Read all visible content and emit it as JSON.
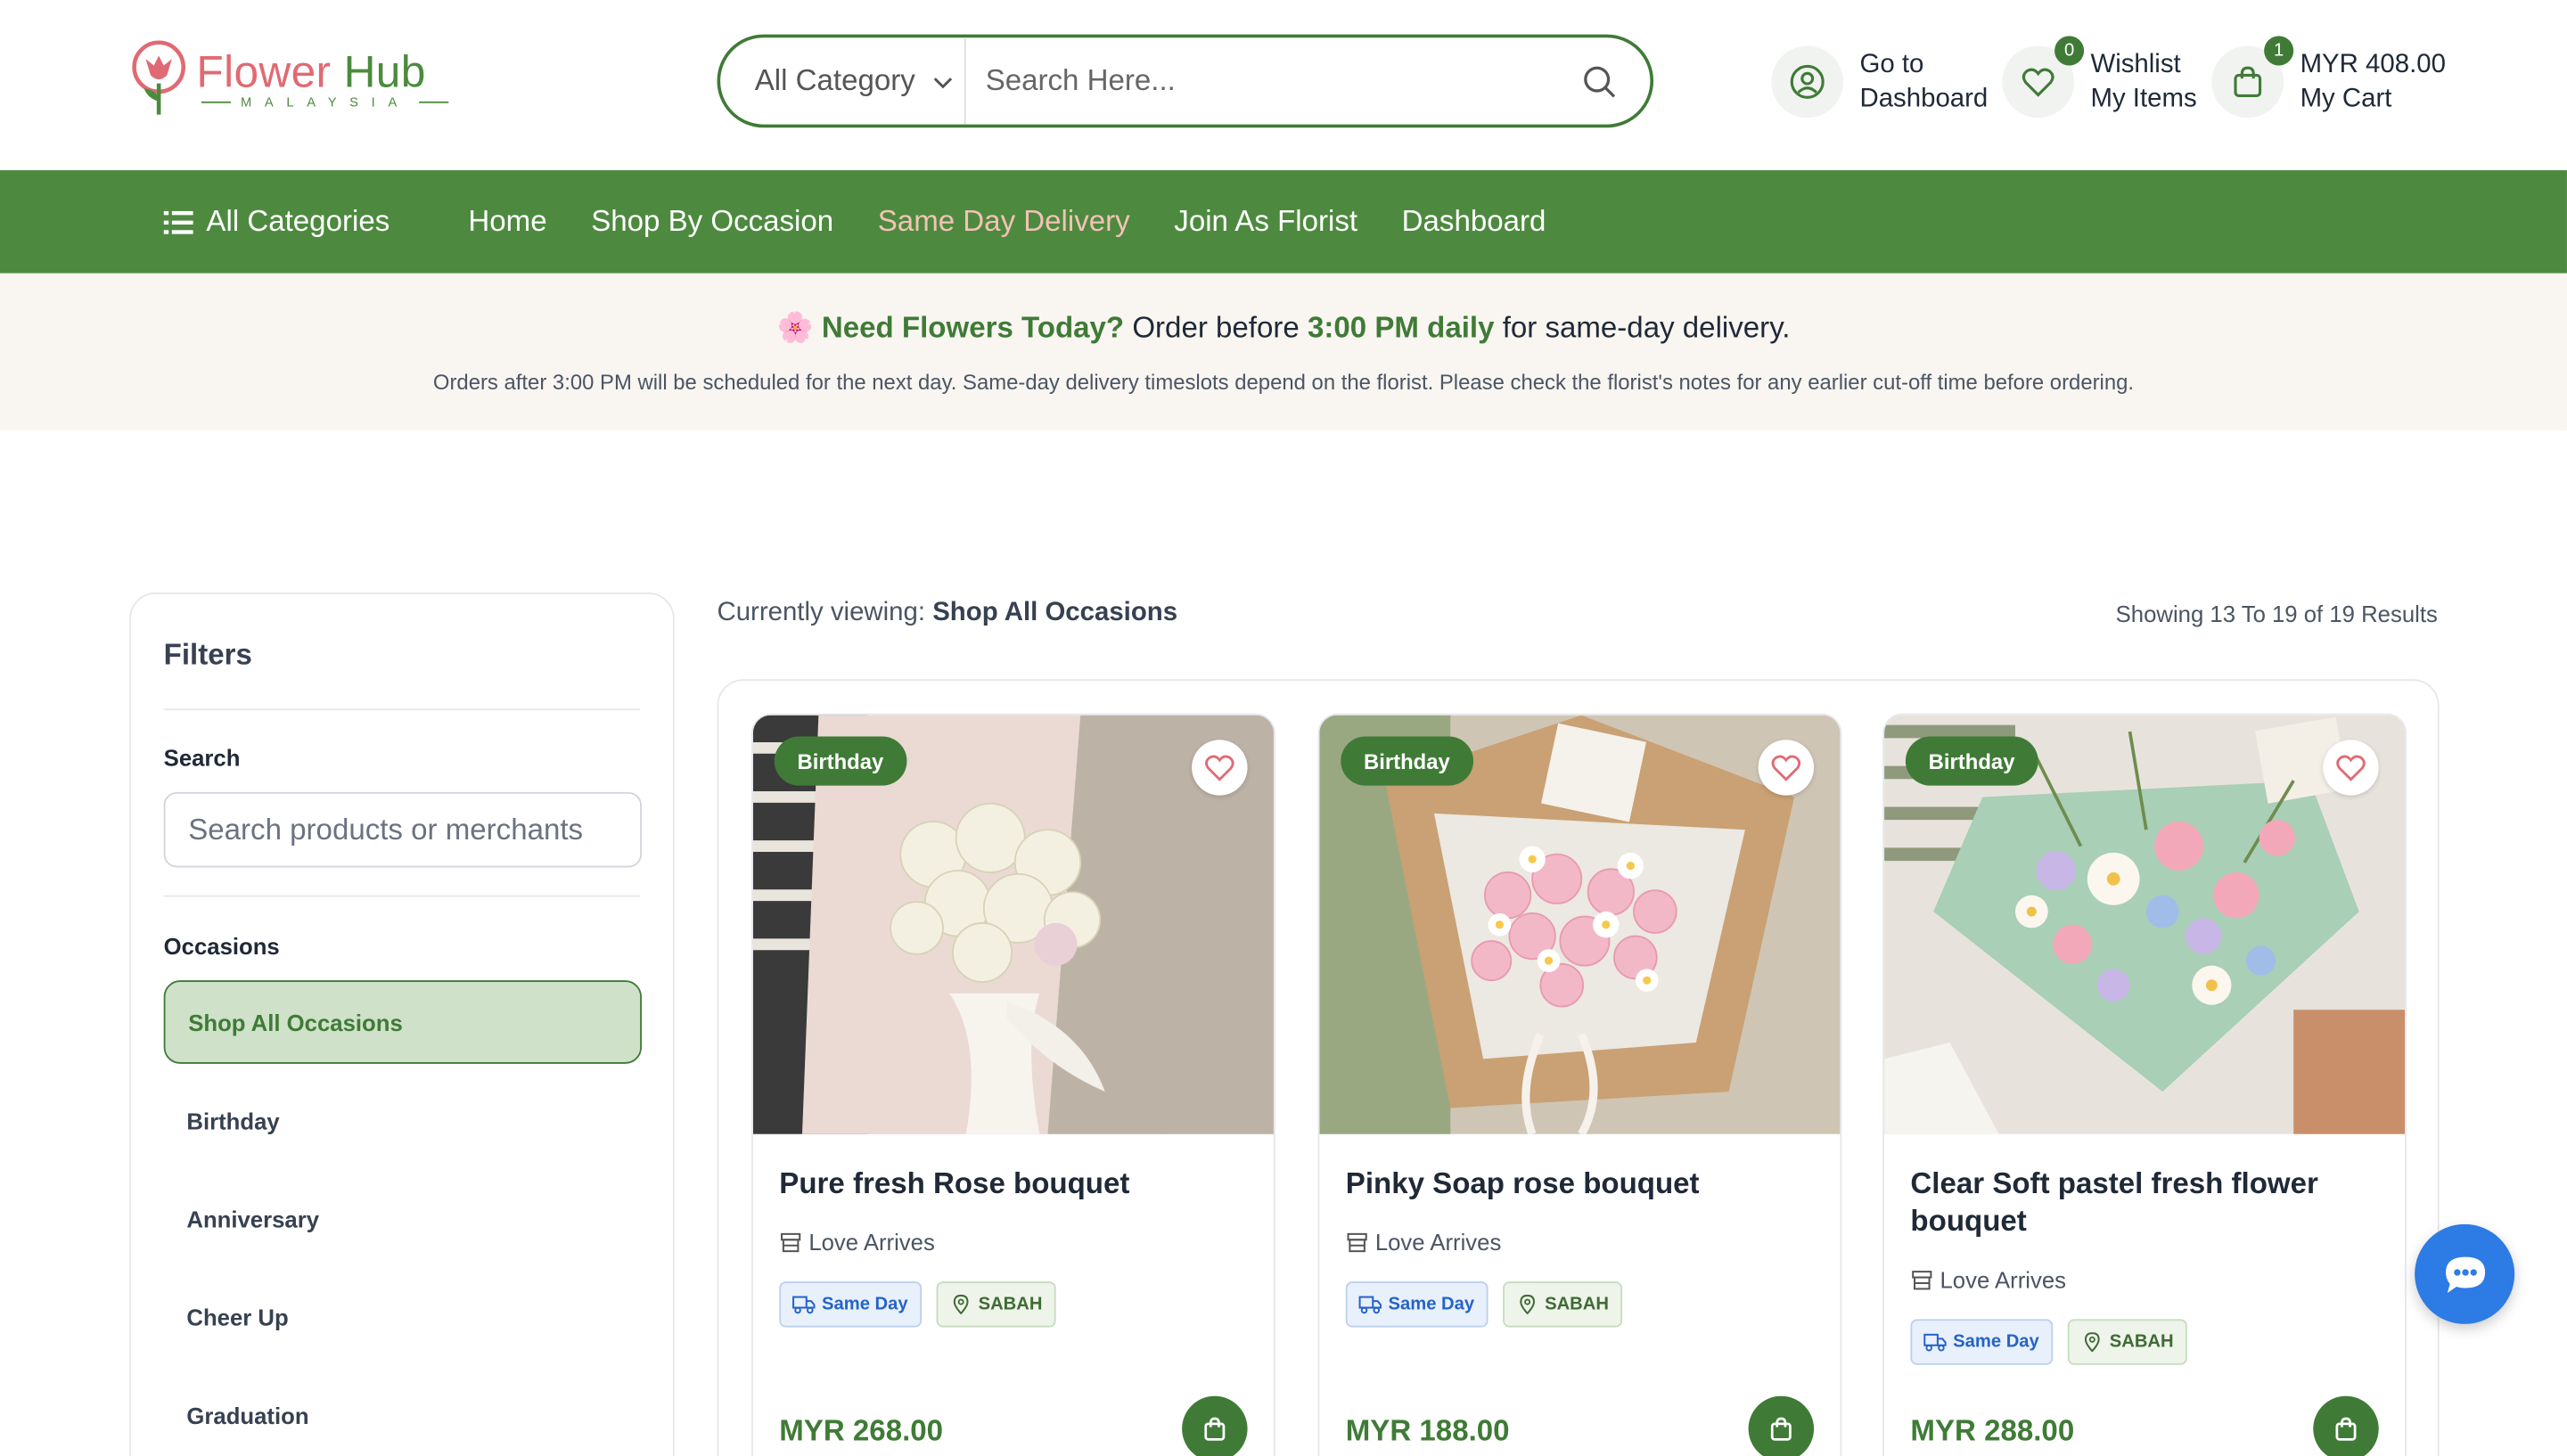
{
  "header": {
    "logo_name_a": "Flower",
    "logo_name_b": "Hub",
    "logo_sub": "MALAYSIA",
    "search_category": "All Category",
    "search_placeholder": "Search Here...",
    "dashboard_line1": "Go to",
    "dashboard_line2": "Dashboard",
    "wishlist_count": "0",
    "wishlist_line1": "Wishlist",
    "wishlist_line2": "My Items",
    "cart_count": "1",
    "cart_total": "MYR 408.00",
    "cart_label": "My Cart"
  },
  "nav": {
    "all_categories": "All Categories",
    "items": [
      "Home",
      "Shop By Occasion",
      "Same Day Delivery",
      "Join As Florist",
      "Dashboard"
    ],
    "active_index": 2
  },
  "banner": {
    "emoji": "🌸",
    "lead": "Need Flowers Today?",
    "mid": "Order before",
    "time": "3:00 PM daily",
    "tail": "for same-day delivery.",
    "note": "Orders after 3:00 PM will be scheduled for the next day. Same-day delivery timeslots depend on the florist. Please check the florist's notes for any earlier cut-off time before ordering."
  },
  "filters": {
    "title": "Filters",
    "search_label": "Search",
    "search_placeholder": "Search products or merchants",
    "occasions_label": "Occasions",
    "occasions": [
      "Shop All Occasions",
      "Birthday",
      "Anniversary",
      "Cheer Up",
      "Graduation"
    ],
    "selected_index": 0
  },
  "results": {
    "viewing_prefix": "Currently viewing:",
    "viewing_value": "Shop All Occasions",
    "showing": "Showing 13 To 19 of 19 Results"
  },
  "products": [
    {
      "tag": "Birthday",
      "title": "Pure fresh Rose bouquet",
      "shop": "Love Arrives",
      "delivery": "Same Day",
      "location": "SABAH",
      "price": "MYR 268.00"
    },
    {
      "tag": "Birthday",
      "title": "Pinky Soap rose bouquet",
      "shop": "Love Arrives",
      "delivery": "Same Day",
      "location": "SABAH",
      "price": "MYR 188.00"
    },
    {
      "tag": "Birthday",
      "title": "Clear Soft pastel fresh flower bouquet",
      "shop": "Love Arrives",
      "delivery": "Same Day",
      "location": "SABAH",
      "price": "MYR 288.00"
    }
  ],
  "colors": {
    "brand_green": "#4d8a3f",
    "dark_green": "#3f7b36",
    "logo_pink": "#e06a73",
    "accent_nav": "#f4c2b6",
    "chat_blue": "#2d7be5"
  },
  "icons": {
    "search": "search-icon",
    "user": "user-circle-icon",
    "wishlist": "heart-icon",
    "cart": "shopping-bag-icon",
    "chat": "chat-bubble-icon"
  }
}
